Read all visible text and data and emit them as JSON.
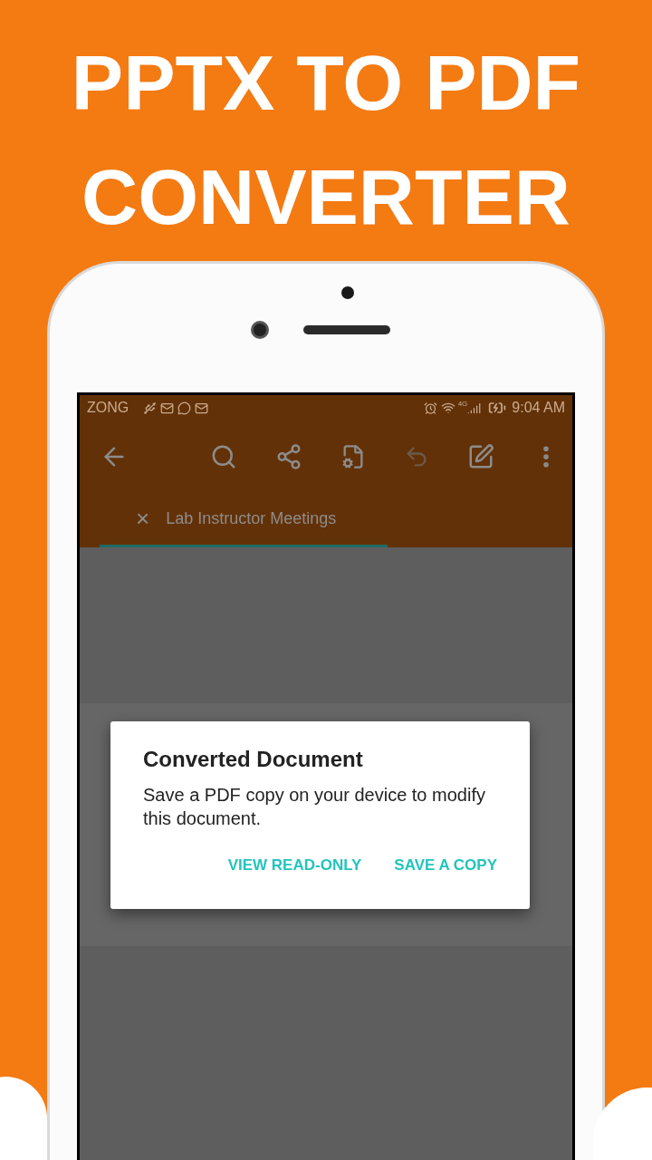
{
  "headline": "PPTX TO PDF CONVERTER",
  "status_bar": {
    "carrier": "ZONG",
    "network_type": "4G",
    "time": "9:04 AM"
  },
  "document_tab": {
    "close": "×",
    "title": "Lab Instructor Meetings",
    "selected": true
  },
  "dialog": {
    "title": "Converted Document",
    "message": "Save a PDF copy on your device to modify this document.",
    "buttons": [
      "VIEW READ-ONLY",
      "SAVE A COPY"
    ]
  }
}
